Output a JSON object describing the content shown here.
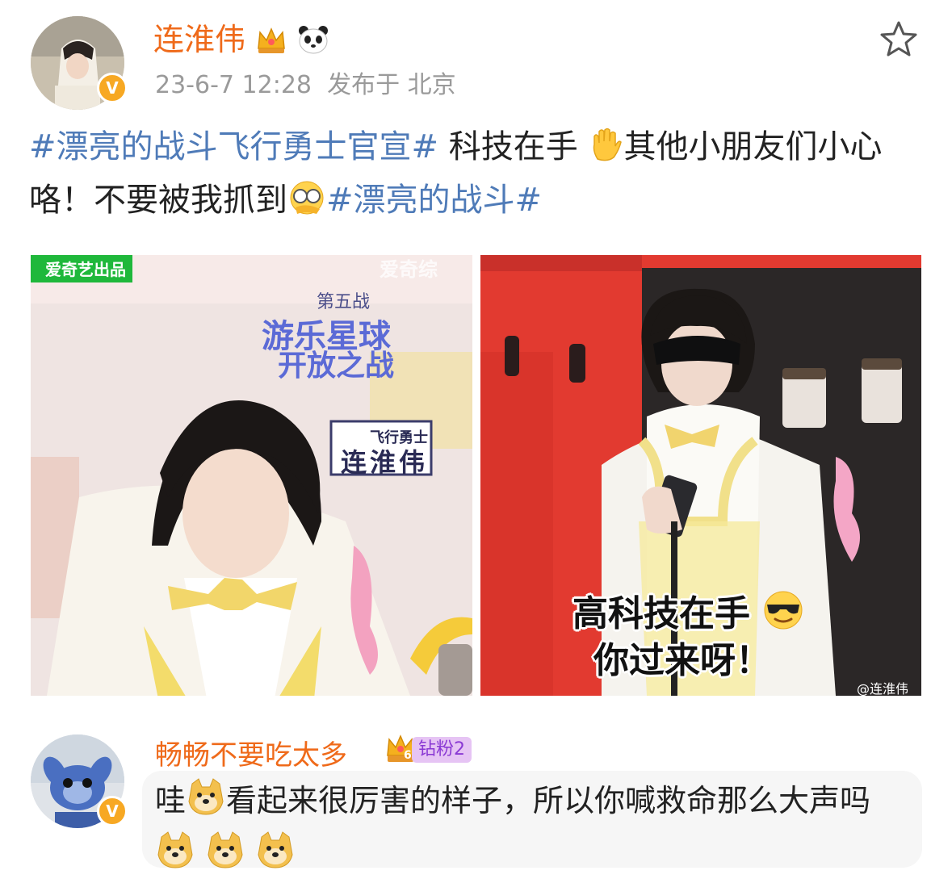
{
  "post": {
    "author": {
      "name": "连淮伟",
      "crown_icon": "crown-icon",
      "panda_icon": "panda-icon",
      "verified_icon": "verified-v-icon"
    },
    "timestamp": "23-6-7 12:28",
    "location": "发布于 北京",
    "favorite_icon": "star-outline-icon",
    "content": {
      "tag1": "#漂亮的战斗飞行勇士官宣#",
      "text1": " 科技在手",
      "emoji1": "raised-hand-icon",
      "text2": "其他小朋友们小心咯！不要被我抓到",
      "emoji2": "facepalm-glasses-icon",
      "tag2": "#漂亮的战斗#"
    },
    "images": [
      {
        "watermark_topleft": "爱奇艺出品",
        "watermark_topright": "爱奇综",
        "episode": "第五战",
        "title_line1": "游乐星球",
        "title_line2": "开放之战",
        "role_line1": "飞行勇士",
        "role_line2": "连淮伟"
      },
      {
        "caption_line1": "高科技在手",
        "caption_emoji": "sunglasses-emoji-icon",
        "caption_line2": "你过来呀！",
        "watermark": "@连淮伟"
      }
    ]
  },
  "comment": {
    "author": "畅畅不要吃太多",
    "badge_label": "钻粉2",
    "badge_level": "6",
    "text_prefix": "哇",
    "text_main": "看起来很厉害的样子，所以你喊救命那么大声吗",
    "emoji": "doge-icon"
  },
  "colors": {
    "name_orange": "#ef6a1a",
    "hashtag_blue": "#4f7bb8",
    "meta_gray": "#9a9a9a",
    "verified_yellow": "#f7a823"
  }
}
